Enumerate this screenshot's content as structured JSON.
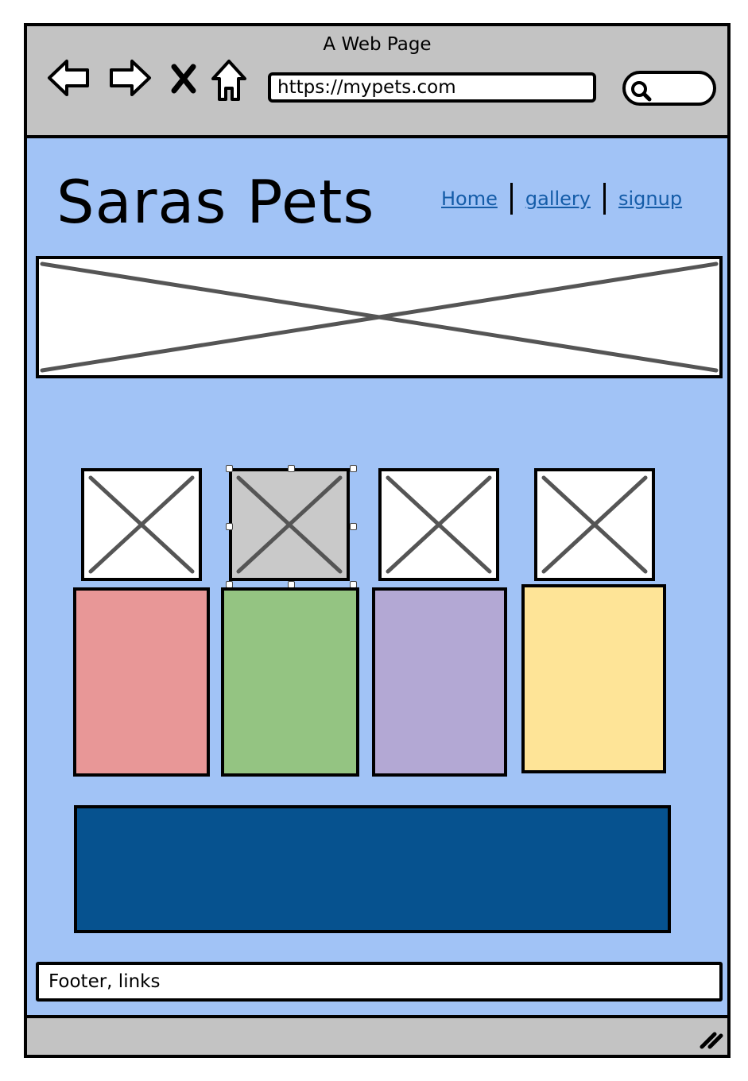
{
  "window": {
    "title": "A Web Page"
  },
  "browser": {
    "url": "https://mypets.com",
    "nav_icons": [
      "back-arrow-icon",
      "forward-arrow-icon",
      "close-x-icon",
      "home-icon",
      "search-icon"
    ]
  },
  "site": {
    "title": "Saras Pets",
    "nav": [
      {
        "label": "Home"
      },
      {
        "label": "gallery"
      },
      {
        "label": "signup"
      }
    ]
  },
  "content": {
    "thumbnails": [
      {
        "selected": false
      },
      {
        "selected": true
      },
      {
        "selected": false
      },
      {
        "selected": false
      }
    ],
    "cards": [
      {
        "color": "#e89797"
      },
      {
        "color": "#94c482"
      },
      {
        "color": "#b3a8d4"
      },
      {
        "color": "#fee497"
      }
    ],
    "hero_color": "#06528f"
  },
  "footer": {
    "text": "Footer, links"
  },
  "colors": {
    "page_background": "#a1c3f6",
    "chrome": "#c3c3c3",
    "link": "#145ca8"
  }
}
